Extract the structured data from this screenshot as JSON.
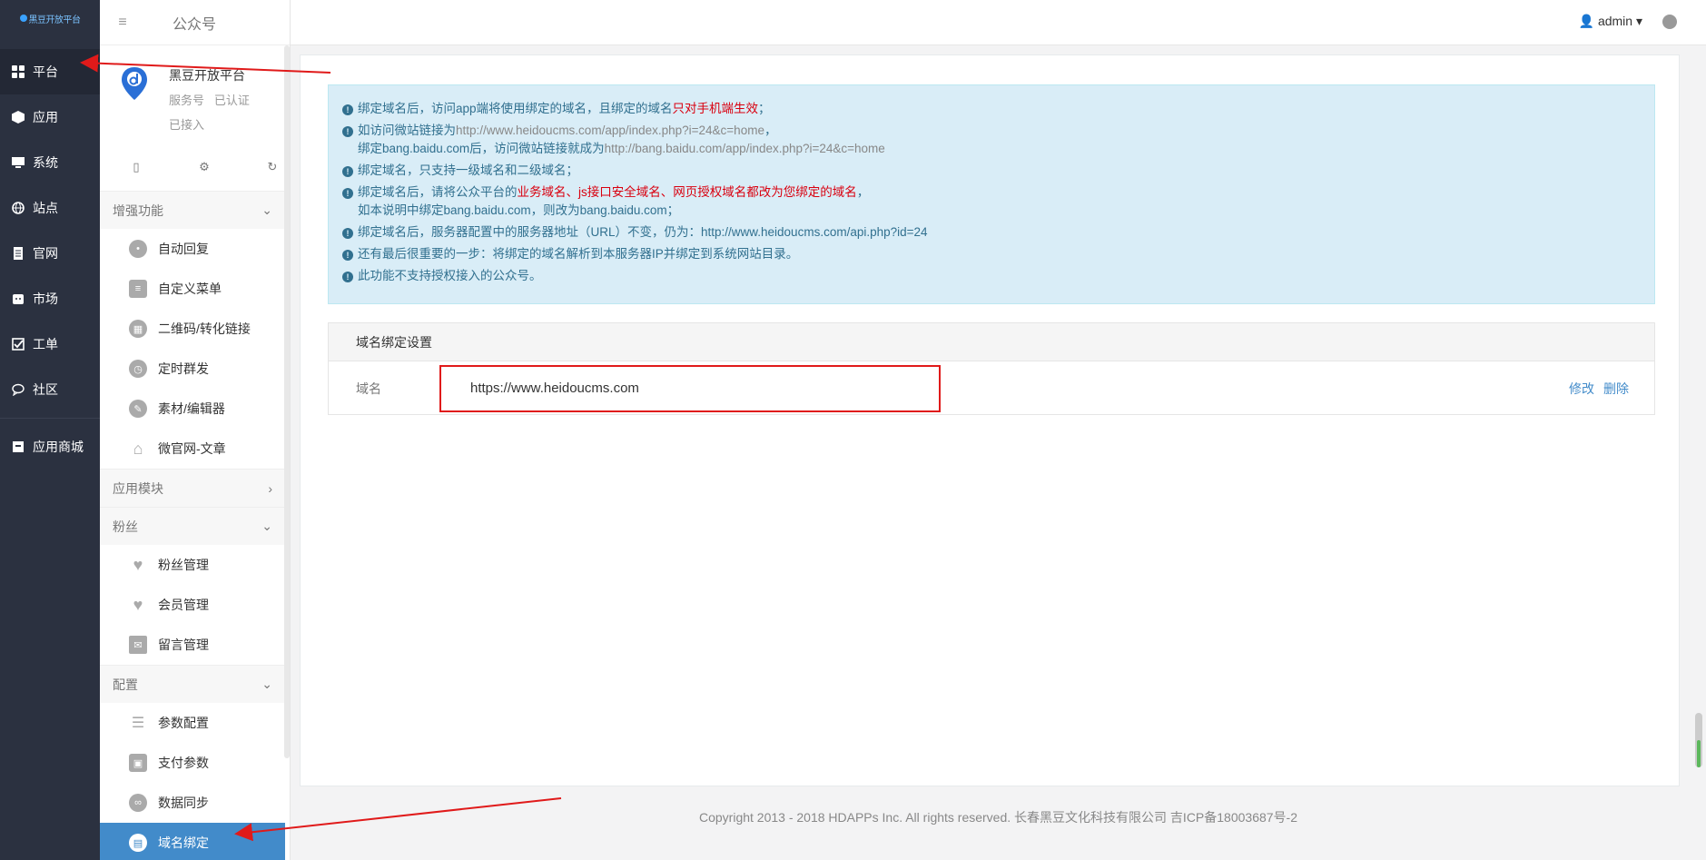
{
  "logo_text": "黑豆开放平台",
  "leftnav": [
    {
      "label": "平台",
      "icon": "grid-icon",
      "active": true
    },
    {
      "label": "应用",
      "icon": "cube-icon"
    },
    {
      "label": "系统",
      "icon": "monitor-icon"
    },
    {
      "label": "站点",
      "icon": "globe-icon"
    },
    {
      "label": "官网",
      "icon": "document-icon"
    },
    {
      "label": "市场",
      "icon": "shop-icon"
    },
    {
      "label": "工单",
      "icon": "checkbox-icon"
    },
    {
      "label": "社区",
      "icon": "chat-icon"
    },
    {
      "label": "应用商城",
      "icon": "store-icon"
    }
  ],
  "subnav": {
    "title": "公众号",
    "account": {
      "name": "黑豆开放平台",
      "type": "服务号",
      "verified": "已认证",
      "status": "已接入"
    },
    "groups": [
      {
        "title": "增强功能",
        "chevron": "down",
        "items": [
          "自动回复",
          "自定义菜单",
          "二维码/转化链接",
          "定时群发",
          "素材/编辑器",
          "微官网-文章"
        ]
      },
      {
        "title": "应用模块",
        "chevron": "right",
        "items": []
      },
      {
        "title": "粉丝",
        "chevron": "down",
        "items": [
          "粉丝管理",
          "会员管理",
          "留言管理"
        ]
      },
      {
        "title": "配置",
        "chevron": "down",
        "items": [
          "参数配置",
          "支付参数",
          "数据同步",
          "域名绑定"
        ]
      }
    ],
    "active_item": "域名绑定"
  },
  "topbar": {
    "user": "admin"
  },
  "alert": {
    "l1a": "绑定域名后，访问app端将使用绑定的域名，且绑定的域名",
    "l1b": "只对手机端生效",
    "l1c": "；",
    "l2a": "如访问微站链接为",
    "l2b": "http://www.heidoucms.com/app/index.php?i=24&c=home",
    "l2c": "，",
    "l3a": "绑定bang.baidu.com后，访问微站链接就成为",
    "l3b": "http://bang.baidu.com/app/index.php?i=24&c=home",
    "l4": "绑定域名，只支持一级域名和二级域名；",
    "l5a": "绑定域名后，请将公众平台的",
    "l5b": "业务域名、js接口安全域名、网页授权域名都改为您绑定的域名",
    "l5c": "，",
    "l6": "如本说明中绑定bang.baidu.com，则改为bang.baidu.com；",
    "l7": "绑定域名后，服务器配置中的服务器地址（URL）不变，仍为：http://www.heidoucms.com/api.php?id=24",
    "l8": "还有最后很重要的一步：将绑定的域名解析到本服务器IP并绑定到系统网站目录。",
    "l9": "此功能不支持授权接入的公众号。"
  },
  "panel": {
    "title": "域名绑定设置",
    "label": "域名",
    "value": "https://www.heidoucms.com",
    "edit": "修改",
    "delete": "删除"
  },
  "footer": "Copyright 2013 - 2018 HDAPPs Inc. All rights reserved. 长春黑豆文化科技有限公司 吉ICP备18003687号-2",
  "colors": {
    "accent": "#428bca",
    "nav_bg": "#2b3140",
    "alert_red": "#d9000f",
    "highlight_box": "#e01a1a",
    "arrow": "#e01a1a"
  }
}
